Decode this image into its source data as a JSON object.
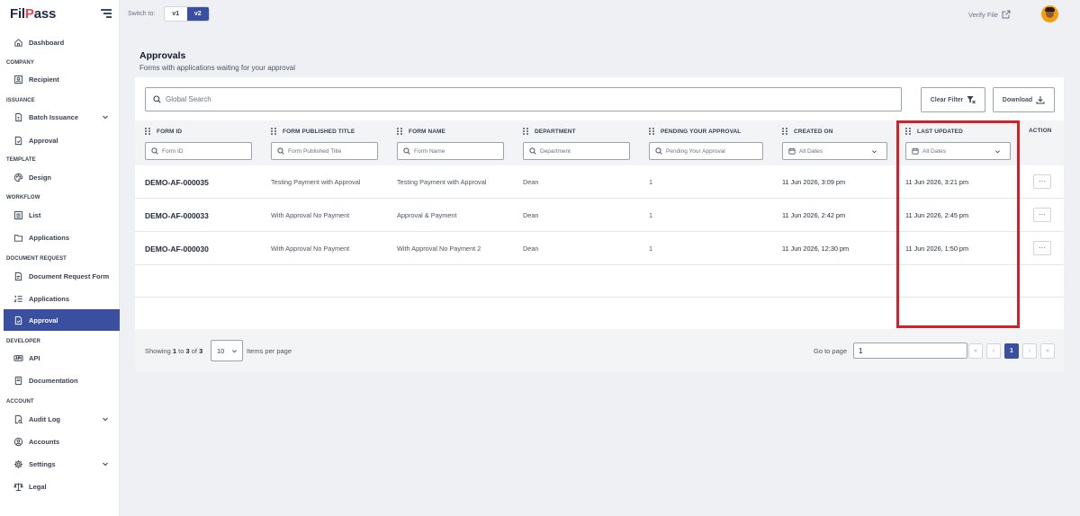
{
  "app": {
    "logo": "FilPass"
  },
  "sidebar": {
    "items": [
      {
        "label": "Dashboard",
        "icon": "home-icon"
      },
      {
        "section": "COMPANY"
      },
      {
        "label": "Recipient",
        "icon": "contact-icon"
      },
      {
        "section": "ISSUANCE"
      },
      {
        "label": "Batch Issuance",
        "icon": "batch-icon"
      },
      {
        "label": "Approval",
        "icon": "approval-doc-icon"
      },
      {
        "section": "TEMPLATE"
      },
      {
        "label": "Design",
        "icon": "palette-icon"
      },
      {
        "section": "WORKFLOW"
      },
      {
        "label": "List",
        "icon": "list-icon"
      },
      {
        "label": "Applications",
        "icon": "folder-icon"
      },
      {
        "section": "DOCUMENT REQUEST"
      },
      {
        "label": "Document Request Form",
        "icon": "form-icon"
      },
      {
        "label": "Applications",
        "icon": "list-numbered-icon"
      },
      {
        "label": "Approval",
        "icon": "approval-doc-icon",
        "active": true
      },
      {
        "section": "DEVELOPER"
      },
      {
        "label": "API",
        "icon": "api-icon"
      },
      {
        "label": "Documentation",
        "icon": "book-icon"
      },
      {
        "section": "ACCOUNT"
      },
      {
        "label": "Audit Log",
        "icon": "audit-icon"
      },
      {
        "label": "Accounts",
        "icon": "user-circle-icon"
      },
      {
        "label": "Settings",
        "icon": "gear-icon"
      },
      {
        "label": "Legal",
        "icon": "scale-icon"
      }
    ]
  },
  "topbar": {
    "switch_label": "Switch to:",
    "versions": [
      "v1",
      "v2"
    ],
    "selected_version": "v2",
    "verify_label": "Verify File"
  },
  "page": {
    "title": "Approvals",
    "subtitle": "Forms with applications waiting for your approval"
  },
  "toolbar": {
    "search_placeholder": "Global Search",
    "clear_filter_label": "Clear Filter",
    "download_label": "Download"
  },
  "table": {
    "columns": [
      {
        "label": "FORM ID",
        "filter": "Form ID"
      },
      {
        "label": "FORM PUBLISHED TITLE",
        "filter": "Form Published Title"
      },
      {
        "label": "FORM NAME",
        "filter": "Form Name"
      },
      {
        "label": "DEPARTMENT",
        "filter": "Department"
      },
      {
        "label": "PENDING YOUR APPROVAL",
        "filter": "Pending Your Approval"
      },
      {
        "label": "CREATED ON",
        "filter": "All Dates"
      },
      {
        "label": "LAST UPDATED",
        "filter": "All Dates"
      },
      {
        "label": "ACTION"
      }
    ],
    "rows": [
      {
        "form_id": "DEMO-AF-000035",
        "published_title": "Testing Payment with Approval",
        "form_name": "Testing Payment with Approval",
        "department": "Dean",
        "pending": "1",
        "created": "11 Jun 2026, 3:09 pm",
        "updated": "11 Jun 2026, 3:21 pm",
        "action": "···"
      },
      {
        "form_id": "DEMO-AF-000033",
        "published_title": "With Approval No Payment",
        "form_name": "Approval & Payment",
        "department": "Dean",
        "pending": "1",
        "created": "11 Jun 2026, 2:42 pm",
        "updated": "11 Jun 2026, 2:45 pm",
        "action": "···"
      },
      {
        "form_id": "DEMO-AF-000030",
        "published_title": "With Approval No Payment",
        "form_name": "With Approval No Payment 2",
        "department": "Dean",
        "pending": "1",
        "created": "11 Jun 2026, 12:30 pm",
        "updated": "11 Jun 2026, 1:50 pm",
        "action": "···"
      }
    ]
  },
  "pagination": {
    "showing_prefix": "Showing",
    "from": "1",
    "to_word": "to",
    "to": "3",
    "of_word": "of",
    "total": "3",
    "per_page": "10",
    "per_page_label": "Items per page",
    "goto_label": "Go to page",
    "goto_value": "1",
    "first": "«",
    "prev": "‹",
    "current": "1",
    "next": "›",
    "last": "»"
  },
  "colors": {
    "primary": "#3b4fa0",
    "highlight": "#d61f26",
    "background": "#eef0f4"
  }
}
